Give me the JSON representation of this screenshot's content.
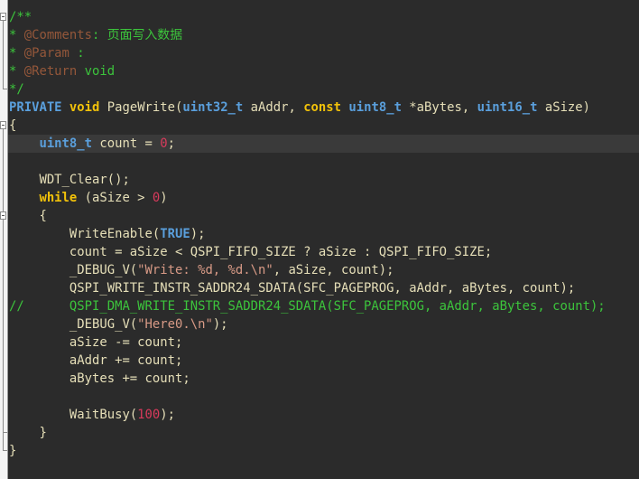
{
  "editor": {
    "current_line": 7,
    "lines": [
      [
        [
          "c",
          "/**"
        ]
      ],
      [
        [
          "c",
          "* "
        ],
        [
          "t",
          "@Comments"
        ],
        [
          "c",
          ": 页面写入数据"
        ]
      ],
      [
        [
          "c",
          "* "
        ],
        [
          "t",
          "@Param"
        ],
        [
          "c",
          " :"
        ]
      ],
      [
        [
          "c",
          "* "
        ],
        [
          "t",
          "@Return"
        ],
        [
          "c",
          " void"
        ]
      ],
      [
        [
          "c",
          "*/"
        ]
      ],
      [
        [
          "y",
          "PRIVATE"
        ],
        [
          "p",
          " "
        ],
        [
          "k",
          "void"
        ],
        [
          "p",
          " PageWrite("
        ],
        [
          "y",
          "uint32_t"
        ],
        [
          "p",
          " aAddr, "
        ],
        [
          "k",
          "const"
        ],
        [
          "p",
          " "
        ],
        [
          "y",
          "uint8_t"
        ],
        [
          "p",
          " *aBytes, "
        ],
        [
          "y",
          "uint16_t"
        ],
        [
          "p",
          " aSize)"
        ]
      ],
      [
        [
          "p",
          "{"
        ]
      ],
      [
        [
          "p",
          "    "
        ],
        [
          "y",
          "uint8_t"
        ],
        [
          "p",
          " count = "
        ],
        [
          "n",
          "0"
        ],
        [
          "p",
          ";"
        ]
      ],
      [],
      [
        [
          "p",
          "    WDT_Clear();"
        ]
      ],
      [
        [
          "p",
          "    "
        ],
        [
          "k",
          "while"
        ],
        [
          "p",
          " (aSize > "
        ],
        [
          "n",
          "0"
        ],
        [
          "p",
          ")"
        ]
      ],
      [
        [
          "p",
          "    {"
        ]
      ],
      [
        [
          "p",
          "        WriteEnable("
        ],
        [
          "y",
          "TRUE"
        ],
        [
          "p",
          ");"
        ]
      ],
      [
        [
          "p",
          "        count = aSize < QSPI_FIFO_SIZE ? aSize : QSPI_FIFO_SIZE;"
        ]
      ],
      [
        [
          "p",
          "        _DEBUG_V("
        ],
        [
          "s",
          "\"Write: %d, %d.\\n\""
        ],
        [
          "p",
          ", aSize, count);"
        ]
      ],
      [
        [
          "p",
          "        QSPI_WRITE_INSTR_SADDR24_SDATA(SFC_PAGEPROG, aAddr, aBytes, count);"
        ]
      ],
      [
        [
          "c",
          "//      QSPI_DMA_WRITE_INSTR_SADDR24_SDATA(SFC_PAGEPROG, aAddr, aBytes, count);"
        ]
      ],
      [
        [
          "p",
          "        _DEBUG_V("
        ],
        [
          "s",
          "\"Here0.\\n\""
        ],
        [
          "p",
          ");"
        ]
      ],
      [
        [
          "p",
          "        aSize -= count;"
        ]
      ],
      [
        [
          "p",
          "        aAddr += count;"
        ]
      ],
      [
        [
          "p",
          "        aBytes += count;"
        ]
      ],
      [],
      [
        [
          "p",
          "        WaitBusy("
        ],
        [
          "n",
          "100"
        ],
        [
          "p",
          ");"
        ]
      ],
      [
        [
          "p",
          "    }"
        ]
      ],
      [
        [
          "p",
          "}"
        ]
      ]
    ]
  }
}
